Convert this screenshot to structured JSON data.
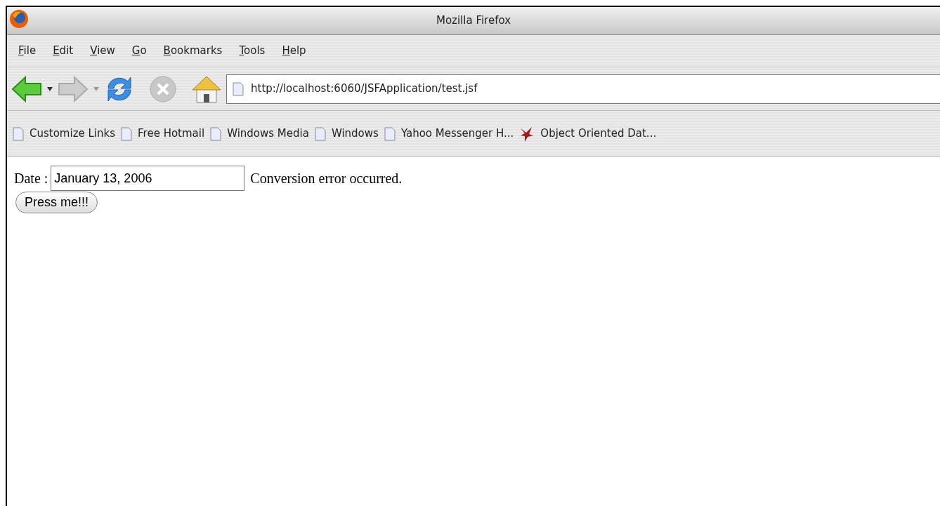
{
  "window": {
    "title": "Mozilla Firefox"
  },
  "menu": [
    "File",
    "Edit",
    "View",
    "Go",
    "Bookmarks",
    "Tools",
    "Help"
  ],
  "address": {
    "value": "http://localhost:6060/JSFApplication/test.jsf"
  },
  "bookmarks": [
    {
      "label": "Customize Links",
      "kind": "page"
    },
    {
      "label": "Free Hotmail",
      "kind": "page"
    },
    {
      "label": "Windows Media",
      "kind": "page"
    },
    {
      "label": "Windows",
      "kind": "page"
    },
    {
      "label": "Yahoo Messenger H...",
      "kind": "page"
    },
    {
      "label": "Object Oriented Dat...",
      "kind": "site"
    }
  ],
  "form": {
    "label": "Date :",
    "value": "January 13, 2006",
    "error": "Conversion error occurred.",
    "button": "Press me!!!"
  }
}
